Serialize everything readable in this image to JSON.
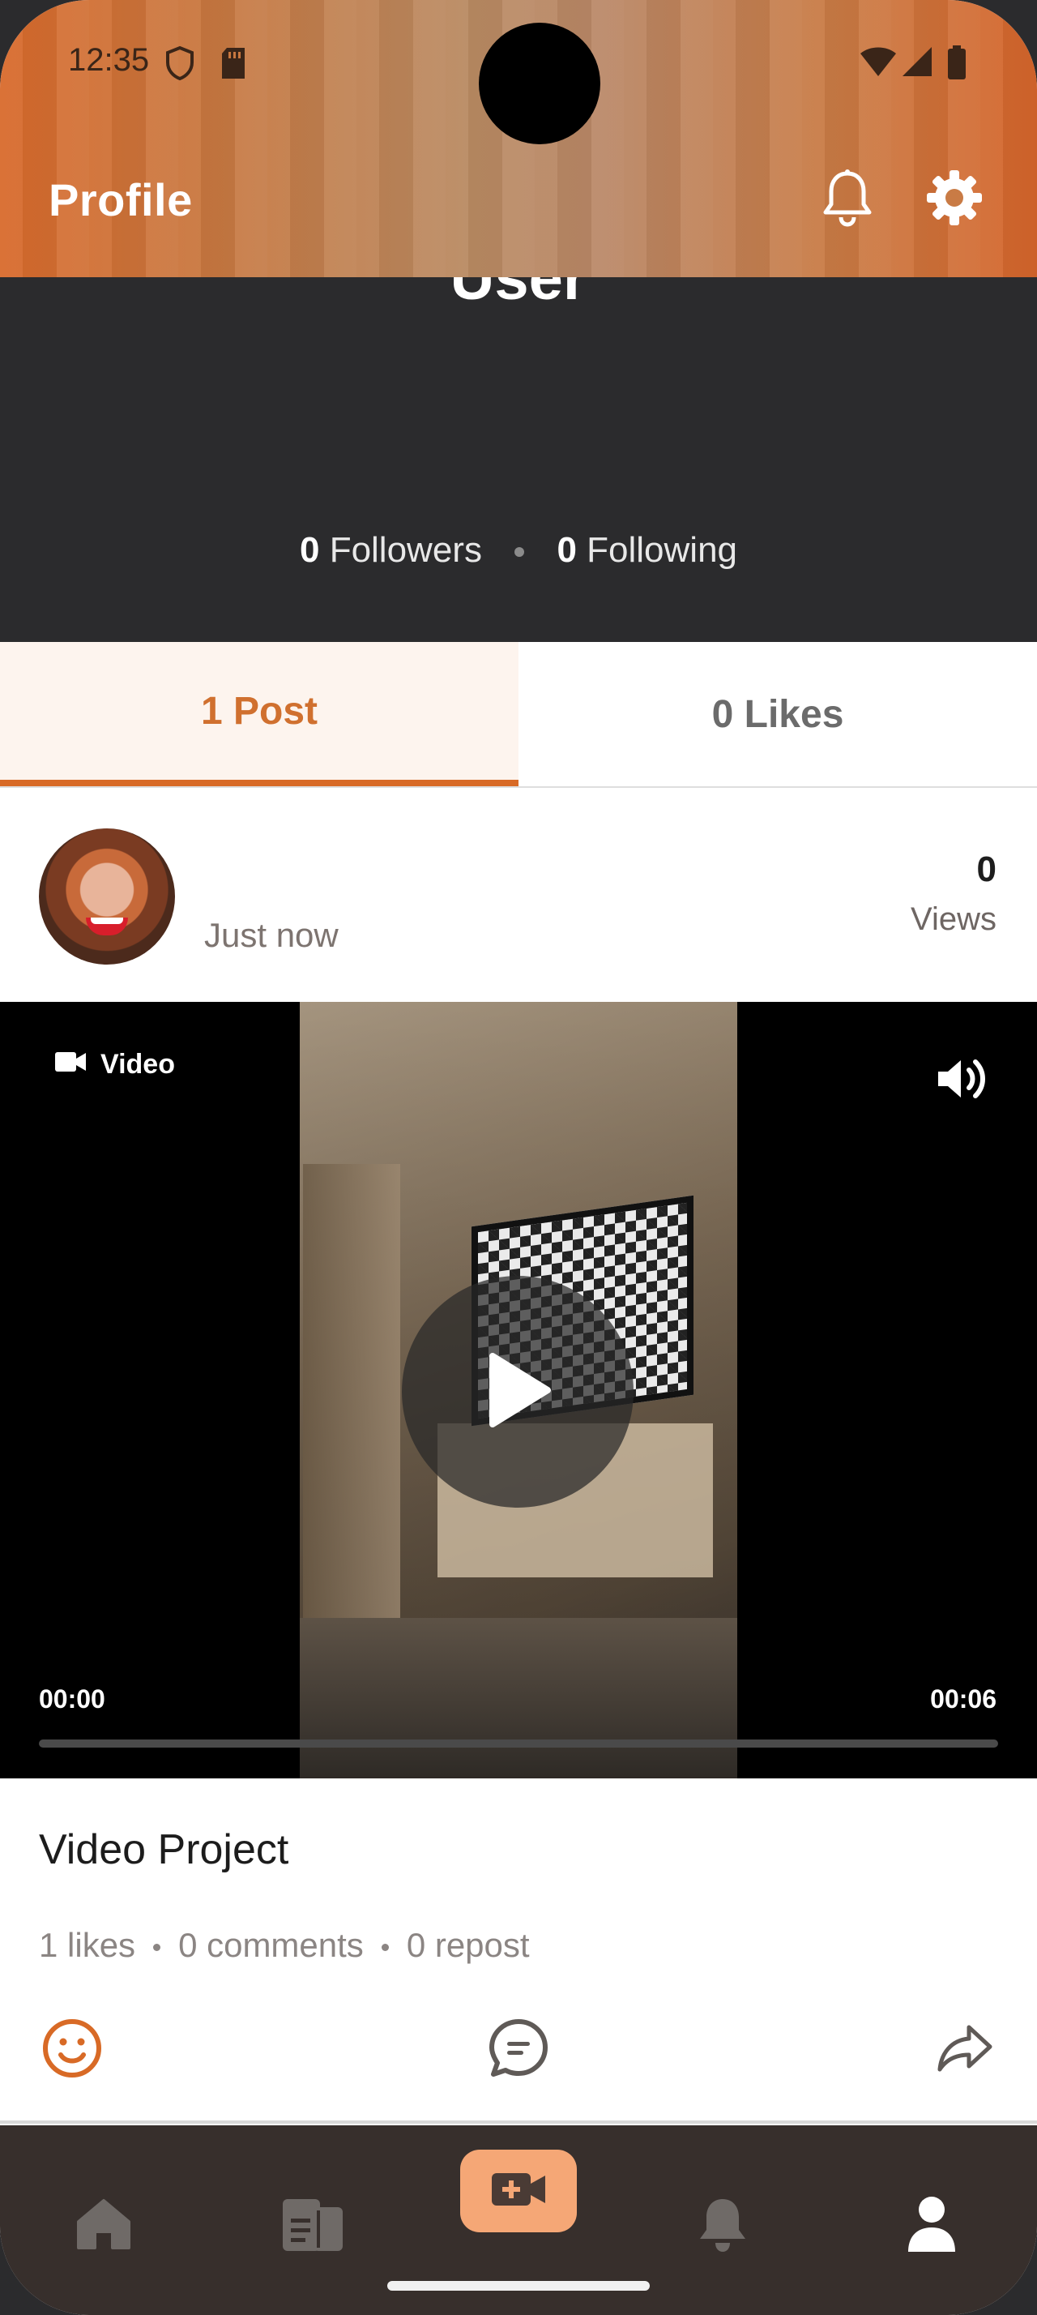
{
  "status_bar": {
    "time": "12:35"
  },
  "header": {
    "title": "Profile"
  },
  "profile": {
    "username": "User",
    "followers_count": "0",
    "followers_label": "Followers",
    "following_count": "0",
    "following_label": "Following"
  },
  "tabs": [
    {
      "label": "1 Post",
      "active": true
    },
    {
      "label": "0 Likes",
      "active": false
    }
  ],
  "post": {
    "time": "Just now",
    "views_count": "0",
    "views_label": "Views",
    "media_type_label": "Video",
    "current_time": "00:00",
    "duration": "00:06",
    "progress": 0,
    "title": "Video Project",
    "stats": {
      "likes": "1 likes",
      "comments": "0 comments",
      "reposts": "0 repost"
    }
  },
  "colors": {
    "accent": "#d86a26",
    "tab_active_bg": "#fdf4ee",
    "profile_bg": "#2b2b2d",
    "nav_bg": "#372f2c",
    "nav_create_bg": "#f5a776"
  },
  "bottom_nav": [
    {
      "icon": "home-icon",
      "active": false
    },
    {
      "icon": "feed-icon",
      "active": false
    },
    {
      "icon": "create-video-icon",
      "active": false
    },
    {
      "icon": "notifications-icon",
      "active": false
    },
    {
      "icon": "profile-icon",
      "active": true
    }
  ]
}
